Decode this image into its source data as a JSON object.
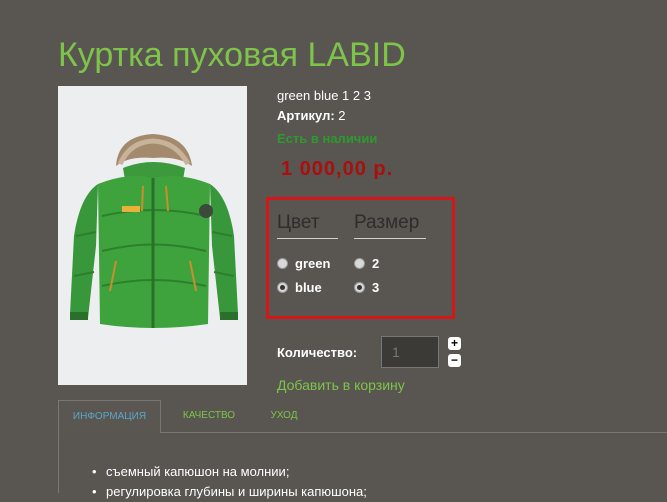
{
  "product": {
    "title": "Куртка пуховая LABID",
    "short_description": "green blue 1 2 3",
    "sku_label": "Артикул:",
    "sku_value": "2",
    "stock": "Есть в наличии",
    "price": "1 000,00 р."
  },
  "options": {
    "color": {
      "title": "Цвет",
      "choices": [
        {
          "label": "green",
          "selected": false
        },
        {
          "label": "blue",
          "selected": true
        }
      ]
    },
    "size": {
      "title": "Размер",
      "choices": [
        {
          "label": "2",
          "selected": false
        },
        {
          "label": "3",
          "selected": true
        }
      ]
    }
  },
  "quantity": {
    "label": "Количество:",
    "value": "1",
    "plus": "+",
    "minus": "−"
  },
  "add_to_cart": "Добавить в корзину",
  "tabs": [
    {
      "label": "ИНФОРМАЦИЯ",
      "active": true
    },
    {
      "label": "КАЧЕСТВО",
      "active": false
    },
    {
      "label": "УХОД",
      "active": false
    }
  ],
  "features": [
    "съемный капюшон на молнии;",
    "регулировка глубины и ширины капюшона;"
  ],
  "colors": {
    "background": "#595550",
    "accent_green": "#7ec44a",
    "price_red": "#a80f0f",
    "highlight_border": "#d41616",
    "tab_active_text": "#5aa7c9"
  }
}
